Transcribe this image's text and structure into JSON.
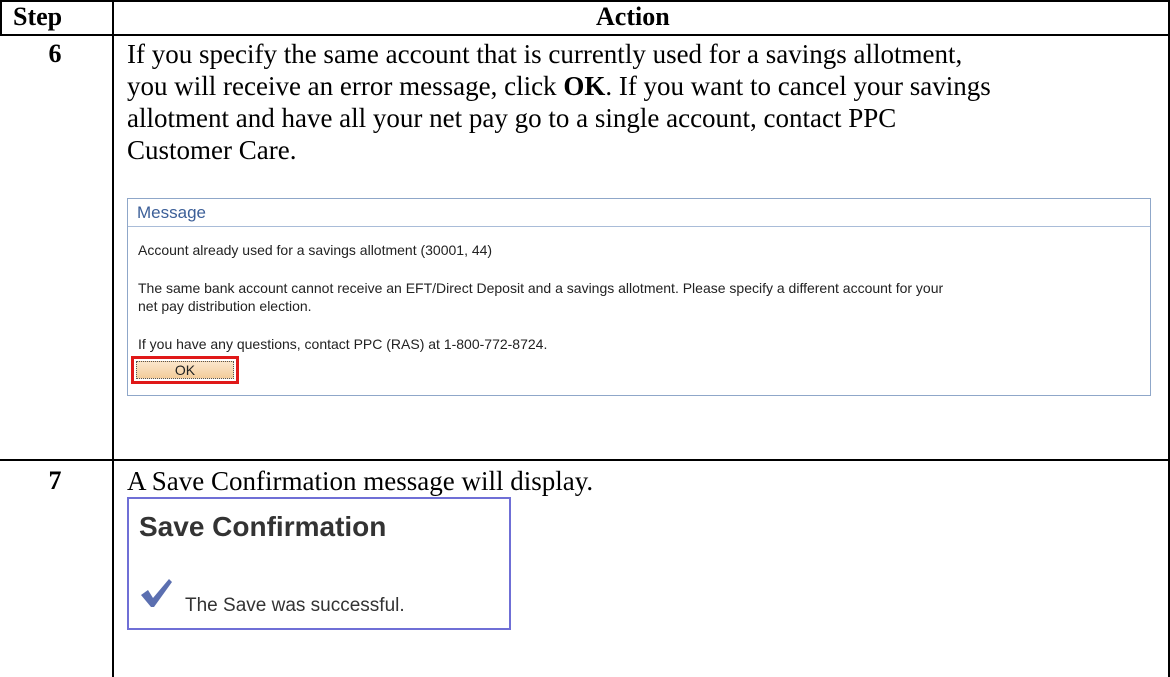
{
  "table": {
    "headers": {
      "step": "Step",
      "action": "Action"
    },
    "rows": [
      {
        "step": "6",
        "lines": [
          "If you specify the same account that is currently used for a savings allotment,",
          "you will receive an error message, click ",
          "OK",
          ".  If you want to cancel your savings",
          "allotment and have all your net pay go to a single account, contact PPC",
          "Customer Care."
        ]
      },
      {
        "step": "7",
        "lines": [
          "A Save Confirmation message will display."
        ]
      }
    ]
  },
  "message_dialog": {
    "title": "Message",
    "line1": "Account already used for a savings allotment (30001, 44)",
    "line2": "The same bank account cannot receive an EFT/Direct Deposit and a savings allotment.  Please specify a different account for your",
    "line3": "net pay distribution election.",
    "line4": "If you have any questions, contact PPC (RAS) at 1-800-772-8724.",
    "ok_label": "OK"
  },
  "save_confirmation": {
    "title": "Save Confirmation",
    "text": "The Save was successful.",
    "check_color": "#5b6fb0"
  }
}
